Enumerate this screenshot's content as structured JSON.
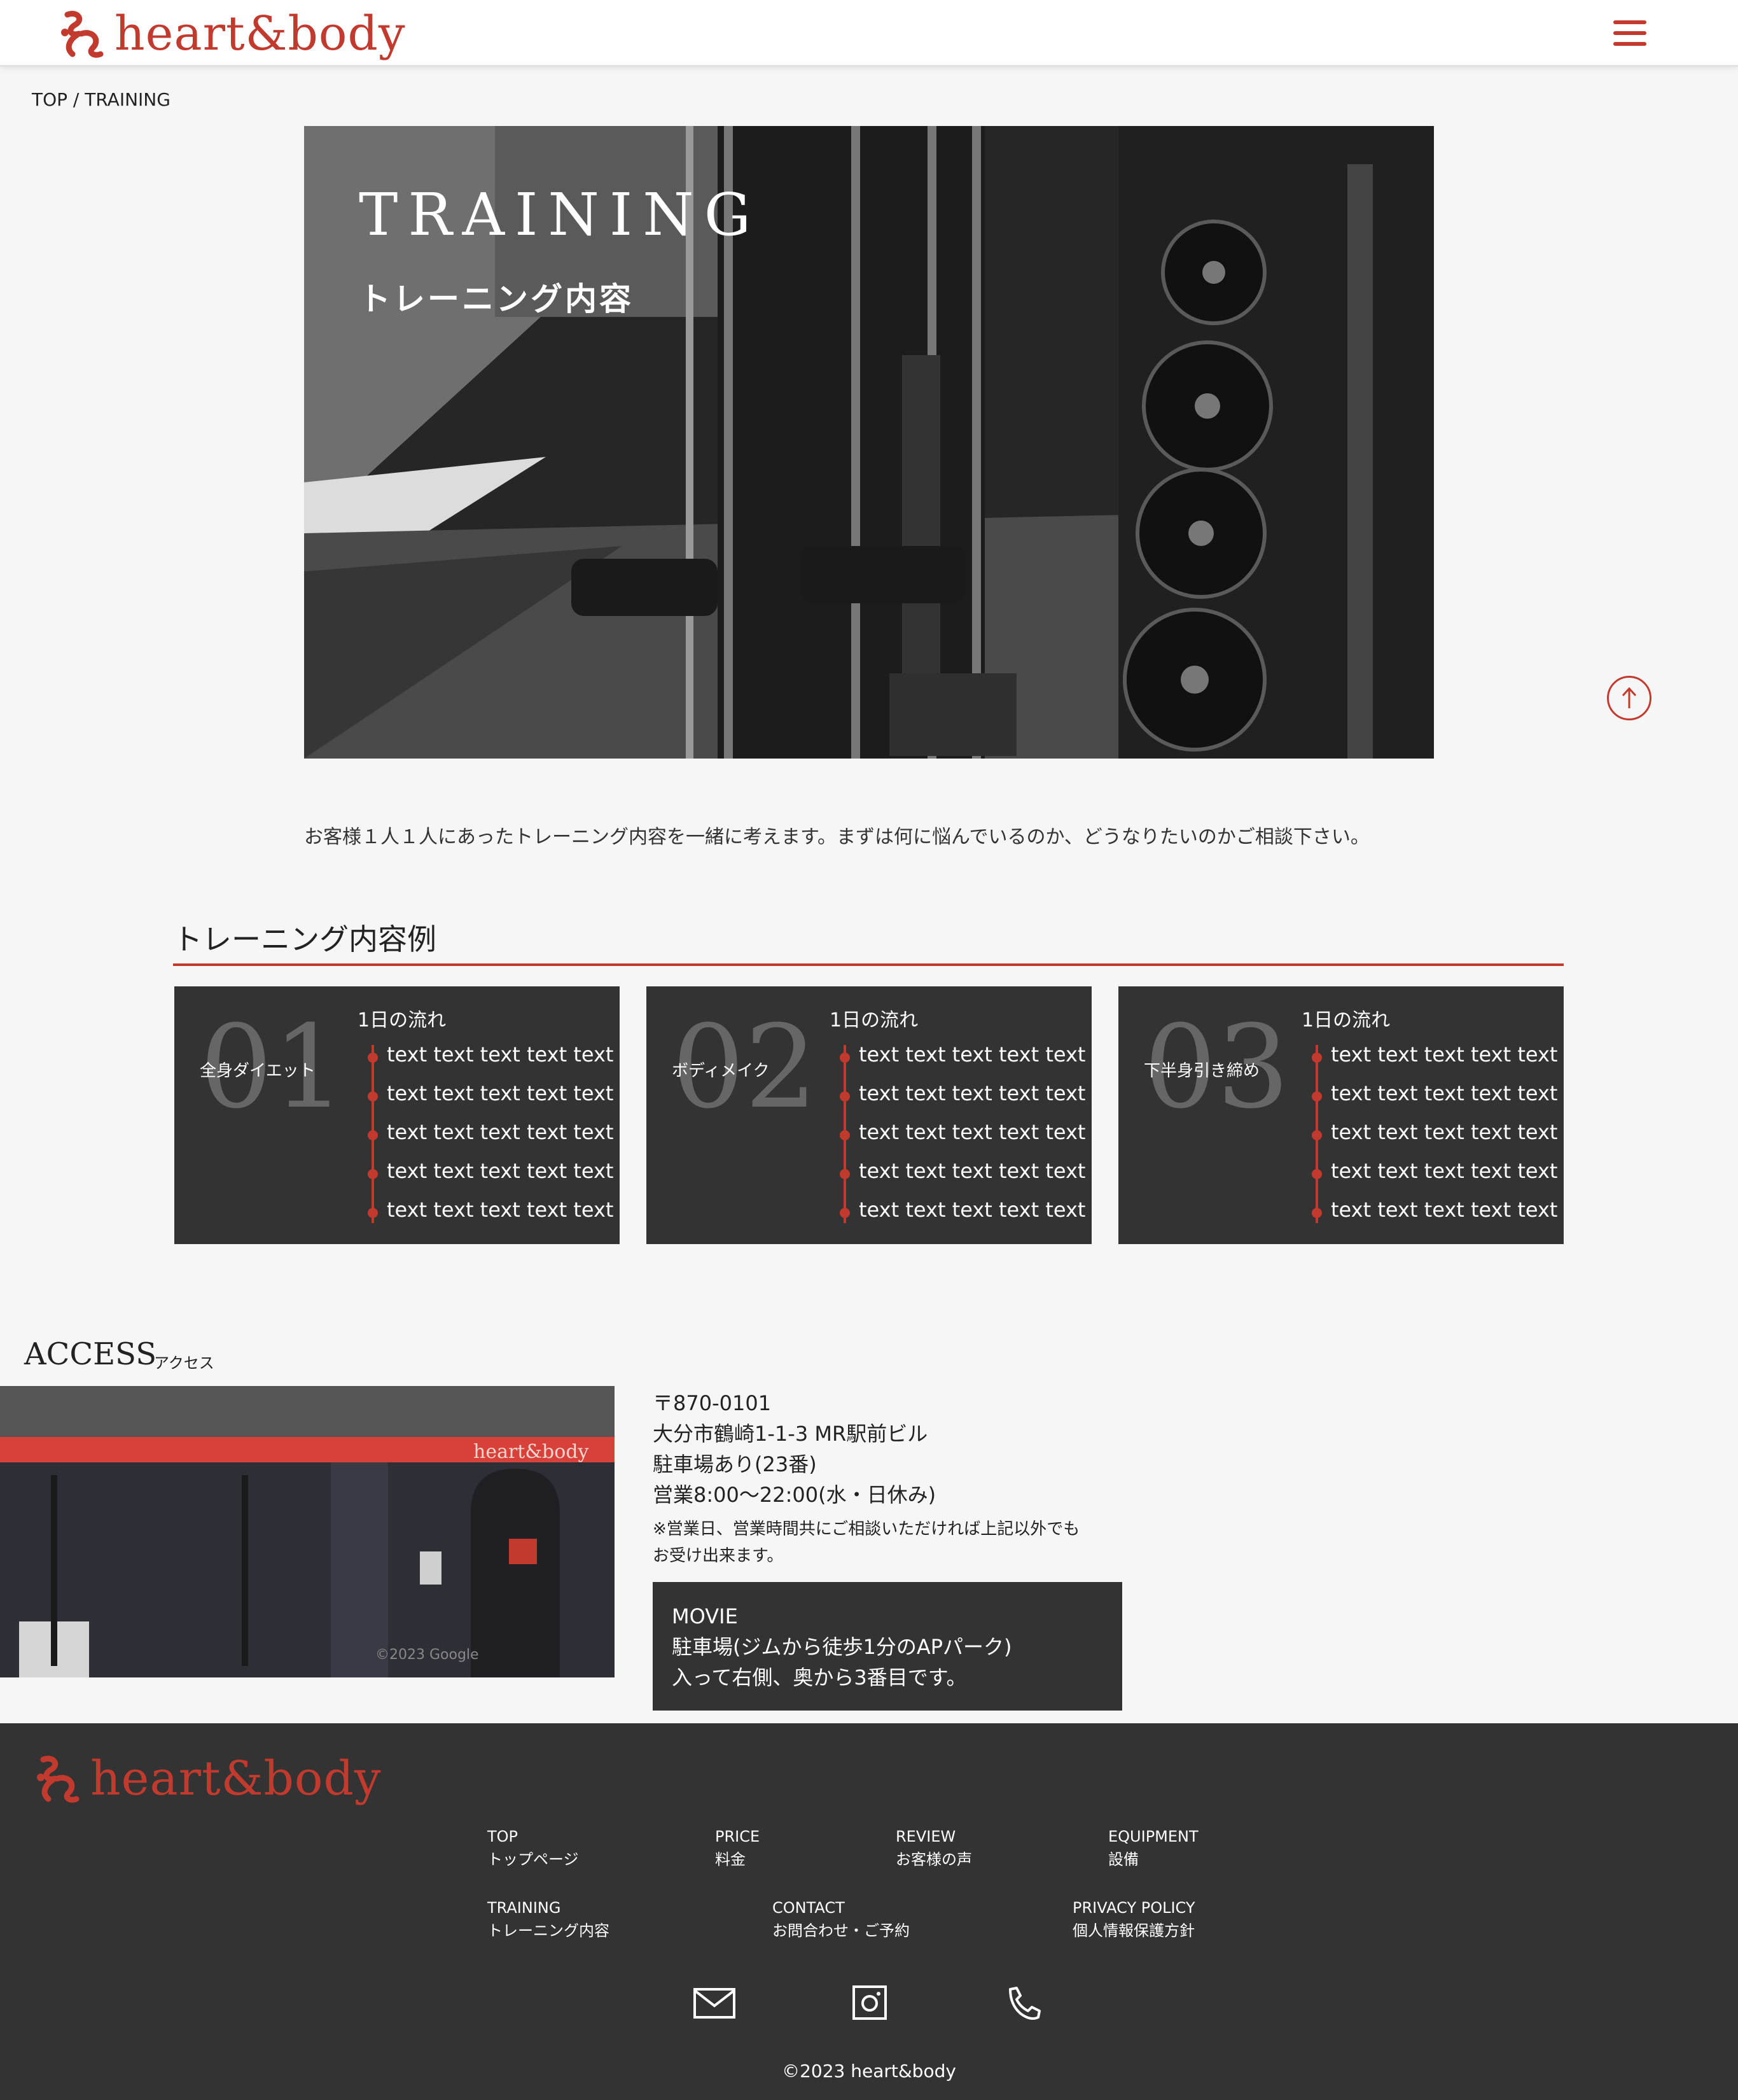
{
  "header": {
    "logo_text": "heart&body",
    "logo_icon": "brand-swirl-icon",
    "menu_icon": "hamburger-menu-icon"
  },
  "breadcrumb": "TOP / TRAINING",
  "hero": {
    "title": "TRAINING",
    "subtitle": "トレーニング内容"
  },
  "intro": "お客様１人１人にあったトレーニング内容を一緒に考えます。まずは何に悩んでいるのか、どうなりたいのかご相談下さい。",
  "examples": {
    "title": "トレーニング内容例",
    "cards": [
      {
        "num": "01",
        "name": "全身ダイエット",
        "flow_label": "1日の流れ",
        "items": [
          "text text text text text",
          "text text text text text",
          "text text text text text",
          "text text text text text",
          "text text text text text"
        ]
      },
      {
        "num": "02",
        "name": "ボディメイク",
        "flow_label": "1日の流れ",
        "items": [
          "text text text text text",
          "text text text text text",
          "text text text text text",
          "text text text text text",
          "text text text text text"
        ]
      },
      {
        "num": "03",
        "name": "下半身引き締め",
        "flow_label": "1日の流れ",
        "items": [
          "text text text text text",
          "text text text text text",
          "text text text text text",
          "text text text text text",
          "text text text text text"
        ]
      }
    ]
  },
  "access": {
    "title": "ACCESS",
    "subtitle": "アクセス",
    "sign_text": "heart&body",
    "photo_credit": "©2023 Google",
    "lines": [
      "〒870-0101",
      "大分市鶴崎1-1-3 MR駅前ビル",
      "駐車場あり(23番)",
      "営業8:00〜22:00(水・日休み)"
    ],
    "note": [
      "※営業日、営業時間共にご相談いただければ上記以外でも",
      "お受け出来ます。"
    ],
    "movie": [
      "MOVIE",
      "駐車場(ジムから徒歩1分のAPパーク)",
      "入って右側、奥から3番目です。"
    ]
  },
  "footer": {
    "logo_text": "heart&body",
    "nav": [
      {
        "en": "TOP",
        "ja": "トップページ"
      },
      {
        "en": "PRICE",
        "ja": "料金"
      },
      {
        "en": "REVIEW",
        "ja": "お客様の声"
      },
      {
        "en": "EQUIPMENT",
        "ja": "設備"
      },
      {
        "en": "TRAINING",
        "ja": "トレーニング内容"
      },
      {
        "en": "CONTACT",
        "ja": "お問合わせ・ご予約"
      },
      {
        "en": "PRIVACY POLICY",
        "ja": "個人情報保護方針"
      }
    ],
    "icons": [
      "mail-icon",
      "instagram-icon",
      "phone-icon"
    ],
    "copyright": "©2023 heart&body"
  },
  "colors": {
    "accent": "#c23a2e",
    "dark": "#333333",
    "bg": "#f6f6f6"
  }
}
